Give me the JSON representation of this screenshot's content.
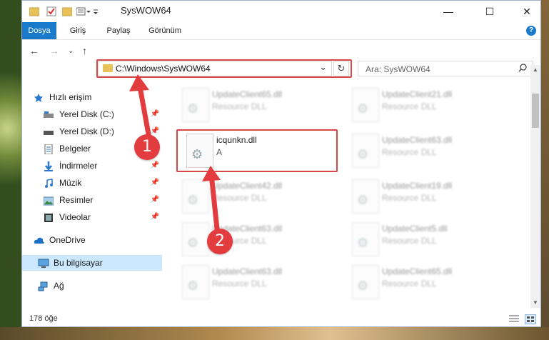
{
  "window": {
    "title": "SysWOW64",
    "minimize_symbol": "—",
    "maximize_symbol": "☐",
    "close_symbol": "✕"
  },
  "ribbon": {
    "tabs": [
      "Dosya",
      "Giriş",
      "Paylaş",
      "Görünüm"
    ],
    "help_symbol": "?"
  },
  "address": {
    "path": "C:\\Windows\\SysWOW64",
    "dropdown_symbol": "⌄",
    "refresh_symbol": "↻"
  },
  "search": {
    "placeholder": "Ara: SysWOW64",
    "icon": "search-icon"
  },
  "sidebar": {
    "items": [
      {
        "label": "Hızlı erişim",
        "icon": "star-icon",
        "pinned": false
      },
      {
        "label": "Yerel Disk (C:)",
        "icon": "drive-icon",
        "pinned": true
      },
      {
        "label": "Yerel Disk (D:)",
        "icon": "drive-icon",
        "pinned": true
      },
      {
        "label": "Belgeler",
        "icon": "document-icon",
        "pinned": true
      },
      {
        "label": "İndirmeler",
        "icon": "download-icon",
        "pinned": true
      },
      {
        "label": "Müzik",
        "icon": "music-icon",
        "pinned": true
      },
      {
        "label": "Resimler",
        "icon": "picture-icon",
        "pinned": true
      },
      {
        "label": "Videolar",
        "icon": "video-icon",
        "pinned": true
      },
      {
        "label": "OneDrive",
        "icon": "cloud-icon",
        "pinned": false
      },
      {
        "label": "Bu bilgisayar",
        "icon": "computer-icon",
        "pinned": false
      },
      {
        "label": "Ağ",
        "icon": "network-icon",
        "pinned": false
      }
    ]
  },
  "files": {
    "col1": [
      {
        "name": "UpdateClient65.dll",
        "type": "Resource DLL"
      },
      {
        "name": "icqunkn.dll",
        "type": "A"
      },
      {
        "name": "UpdateClient42.dll",
        "type": "Resource DLL"
      },
      {
        "name": "UpdateClient63.dll",
        "type": "Resource DLL"
      },
      {
        "name": "UpdateClient63.dll",
        "type": "Resource DLL"
      }
    ],
    "col2": [
      {
        "name": "UpdateClient21.dll",
        "type": "Resource DLL"
      },
      {
        "name": "UpdateClient63.dll",
        "type": "Resource DLL"
      },
      {
        "name": "UpdateClient19.dll",
        "type": "Resource DLL"
      },
      {
        "name": "UpdateClient5.dll",
        "type": "Resource DLL"
      },
      {
        "name": "UpdateClient65.dll",
        "type": "Resource DLL"
      }
    ]
  },
  "status": {
    "count": "178 öğe"
  },
  "callouts": [
    "1",
    "2"
  ],
  "colors": {
    "accent": "#1979ca",
    "highlight_red": "#d9474b",
    "selection": "#cce8ff",
    "folder": "#e8c15a"
  }
}
